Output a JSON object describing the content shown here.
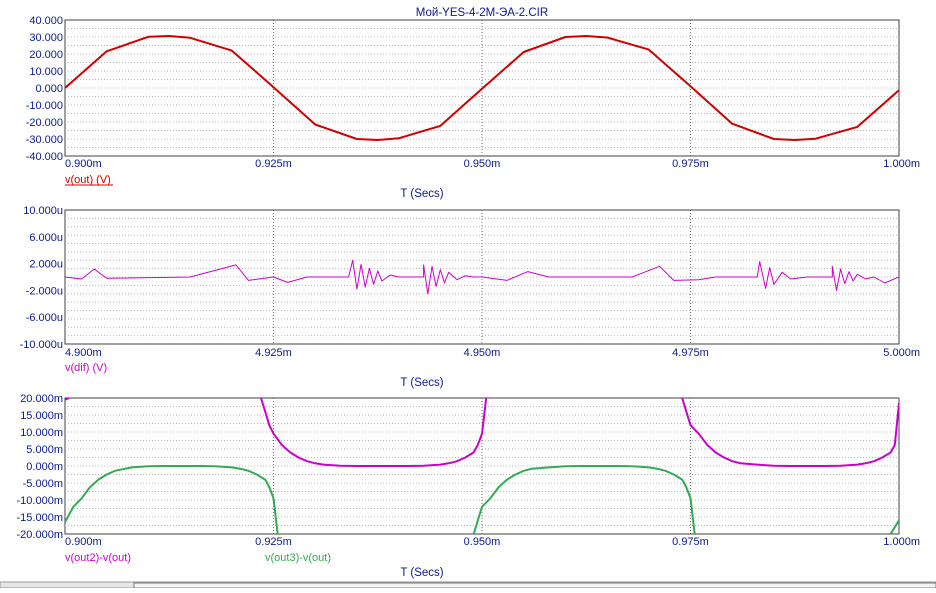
{
  "window": {
    "title": "Мой-YES-4-2M-ЭА-2.CIR"
  },
  "chart_data": [
    {
      "type": "line",
      "xlabel": "T (Secs)",
      "xlim": [
        0.0009,
        0.001
      ],
      "ylim": [
        -40,
        40
      ],
      "xticks": [
        0.0009,
        0.000925,
        0.00095,
        0.000975,
        0.001
      ],
      "xtick_labels": [
        "0.900m",
        "0.925m",
        "0.950m",
        "0.975m",
        "1.000m"
      ],
      "yticks": [
        -40,
        -30,
        -20,
        -10,
        0,
        10,
        20,
        30,
        40
      ],
      "ytick_labels": [
        "-40.000",
        "-30.000",
        "-20.000",
        "-10.000",
        "0.000",
        "10.000",
        "20.000",
        "30.000",
        "40.000"
      ],
      "grid": true,
      "series": [
        {
          "name": "v(out) (V)",
          "color": "#d00000",
          "x": [
            0.0009,
            0.000905,
            0.00091,
            0.0009125,
            0.000915,
            0.00092,
            0.000925,
            0.00093,
            0.000935,
            0.0009375,
            0.00094,
            0.000945,
            0.00095,
            0.000955,
            0.00096,
            0.0009625,
            0.000965,
            0.00097,
            0.000975,
            0.00098,
            0.000985,
            0.0009875,
            0.00099,
            0.000995,
            0.001
          ],
          "y": [
            0,
            21.6,
            30.1,
            30.6,
            29.5,
            22.0,
            0.5,
            -21.5,
            -30.0,
            -30.6,
            -29.6,
            -22.3,
            -0.5,
            21.2,
            30.0,
            30.6,
            29.7,
            22.6,
            1.0,
            -21.0,
            -30.0,
            -30.6,
            -29.8,
            -22.9,
            -1.3
          ]
        }
      ]
    },
    {
      "type": "line",
      "xlabel": "T (Secs)",
      "xlim": [
        0.0049,
        0.005
      ],
      "ylim": [
        -10,
        10
      ],
      "xticks": [
        0.0049,
        0.004925,
        0.00495,
        0.004975,
        0.005
      ],
      "xtick_labels": [
        "4.900m",
        "4.925m",
        "4.950m",
        "4.975m",
        "5.000m"
      ],
      "yticks": [
        -10,
        -6,
        -2,
        2,
        6,
        10
      ],
      "ytick_labels": [
        "-10.000u",
        "-6.000u",
        "-2.000u",
        "2.000u",
        "6.000u",
        "10.000u"
      ],
      "grid": true,
      "series": [
        {
          "name": "v(dif) (V)",
          "color": "#cc00cc",
          "x": [
            0.0049,
            0.004902,
            0.0049035,
            0.004905,
            0.004915,
            0.0049205,
            0.004922,
            0.004925,
            0.0049267,
            0.004929,
            0.004932,
            0.004934,
            0.0049345,
            0.004935,
            0.0049355,
            0.004936,
            0.0049365,
            0.004937,
            0.0049375,
            0.004938,
            0.004939,
            0.00494,
            0.004943,
            0.004943,
            0.0049435,
            0.004944,
            0.0049445,
            0.004945,
            0.0049455,
            0.004946,
            0.004947,
            0.004948,
            0.004949,
            0.00495,
            0.004953,
            0.0049555,
            0.004958,
            0.004968,
            0.0049713,
            0.004973,
            0.004976,
            0.004978,
            0.004983,
            0.0049833,
            0.004984,
            0.0049845,
            0.004985,
            0.004986,
            0.004987,
            0.004989,
            0.004992,
            0.004992,
            0.0049925,
            0.004993,
            0.0049935,
            0.004994,
            0.0049945,
            0.004995,
            0.004996,
            0.004997,
            0.0049983,
            0.005
          ],
          "y": [
            0,
            -0.3,
            1.2,
            -0.2,
            0,
            1.8,
            -0.5,
            0,
            -0.8,
            0,
            0,
            0,
            2.5,
            -1.8,
            1.9,
            -1.5,
            1.3,
            -1.1,
            0.9,
            -0.6,
            0.3,
            0,
            0,
            1.8,
            -2.5,
            1.6,
            -1.4,
            1.1,
            -0.9,
            0.7,
            -0.4,
            0.2,
            0,
            0,
            -0.5,
            0.8,
            0,
            0,
            1.6,
            -0.5,
            -0.4,
            0,
            0,
            2.3,
            -1.7,
            1.4,
            -1.1,
            0.7,
            -0.3,
            0,
            0,
            1.6,
            -2.0,
            1.2,
            -1.0,
            0.8,
            -0.6,
            0.4,
            -0.3,
            0,
            -0.9,
            0
          ]
        }
      ]
    },
    {
      "type": "line",
      "xlabel": "T (Secs)",
      "xlim": [
        0.0009,
        0.001
      ],
      "ylim": [
        -20,
        20
      ],
      "xticks": [
        0.0009,
        0.000925,
        0.00095,
        0.000975,
        0.001
      ],
      "xtick_labels": [
        "0.900m",
        "0.925m",
        "0.950m",
        "0.975m",
        "1.000m"
      ],
      "yticks": [
        -20,
        -15,
        -10,
        -5,
        0,
        5,
        10,
        15,
        20
      ],
      "ytick_labels": [
        "-20.000m",
        "-15.000m",
        "-10.000m",
        "-5.000m",
        "0.000m",
        "5.000m",
        "10.000m",
        "15.000m",
        "20.000m"
      ],
      "grid": true,
      "series": [
        {
          "name": "v(out2)-v(out)",
          "color": "#cc00cc",
          "x": [
            0.0009,
            0.0009005,
            0.000901,
            0.0009235,
            0.000924,
            0.0009245,
            0.000925,
            0.000926,
            0.000927,
            0.000928,
            0.000929,
            0.00093,
            0.000931,
            0.000933,
            0.000935,
            0.000937,
            0.000941,
            0.000943,
            0.000945,
            0.000946,
            0.000947,
            0.000948,
            0.000949,
            0.0009495,
            0.00095,
            0.0009505,
            0.0009735,
            0.000974,
            0.0009745,
            0.000975,
            0.000976,
            0.000977,
            0.000978,
            0.000979,
            0.00098,
            0.000981,
            0.000983,
            0.000985,
            0.000987,
            0.000991,
            0.000993,
            0.000995,
            0.000996,
            0.000997,
            0.000998,
            0.000999,
            0.0009995,
            0.001
          ],
          "y": [
            19.5,
            20,
            null,
            20,
            16,
            12,
            9.5,
            6.2,
            4.0,
            2.5,
            1.4,
            0.8,
            0.4,
            0.05,
            0,
            0,
            0,
            0.05,
            0.4,
            0.8,
            1.4,
            2.5,
            4.0,
            6.2,
            9.5,
            20,
            null,
            20,
            16,
            12,
            9.5,
            6.2,
            4.0,
            2.5,
            1.4,
            0.8,
            0.4,
            0.05,
            0,
            0,
            0.05,
            0.4,
            0.8,
            1.4,
            2.5,
            4.0,
            6.2,
            18.5
          ]
        },
        {
          "name": "v(out3)-v(out)",
          "color": "#33aa55",
          "x": [
            0.0009,
            0.000901,
            0.000902,
            0.000903,
            0.000904,
            0.000905,
            0.000906,
            0.000908,
            0.00091,
            0.000912,
            0.000916,
            0.000918,
            0.00092,
            0.000921,
            0.000922,
            0.000923,
            0.000924,
            0.0009245,
            0.000925,
            0.0009255,
            0.0009485,
            0.000949,
            0.0009495,
            0.00095,
            0.000951,
            0.000952,
            0.000953,
            0.000954,
            0.000955,
            0.000956,
            0.000958,
            0.00096,
            0.000962,
            0.000966,
            0.000968,
            0.00097,
            0.000971,
            0.000972,
            0.000973,
            0.000974,
            0.0009745,
            0.000975,
            0.0009755,
            0.0009985,
            0.000999,
            0.0009995,
            0.001
          ],
          "y": [
            -16.5,
            -12,
            -9.5,
            -6.2,
            -4.0,
            -2.5,
            -1.4,
            -0.4,
            -0.05,
            0,
            0,
            -0.05,
            -0.4,
            -0.8,
            -1.4,
            -2.5,
            -4.0,
            -6.2,
            -9.5,
            -20,
            null,
            -20,
            -16,
            -12,
            -9.5,
            -6.2,
            -4.0,
            -2.5,
            -1.4,
            -0.8,
            -0.4,
            -0.05,
            0,
            0,
            -0.05,
            -0.4,
            -0.8,
            -1.4,
            -2.5,
            -4.0,
            -6.2,
            -9.5,
            -20,
            null,
            -20,
            -18,
            -16
          ]
        }
      ]
    }
  ]
}
